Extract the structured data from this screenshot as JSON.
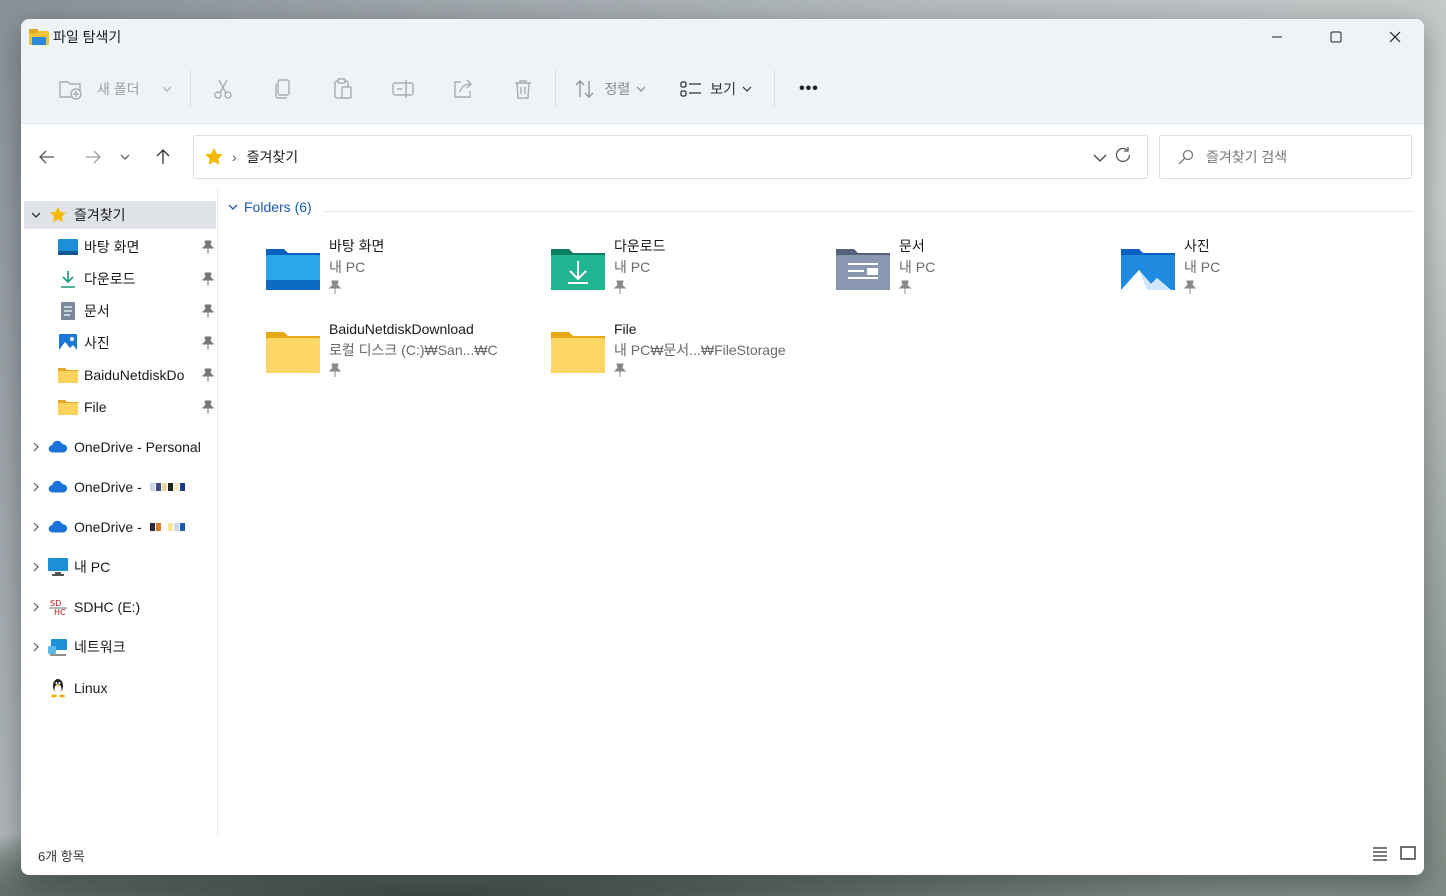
{
  "window": {
    "title": "파일 탐색기"
  },
  "toolbar": {
    "new_folder_label": "새 폴더",
    "sort_label": "정렬",
    "view_label": "보기",
    "more_label": "•••"
  },
  "address": {
    "location": "즐겨찾기",
    "separator": "›",
    "search_placeholder": "즐겨찾기 검색"
  },
  "sidebar": {
    "favorites_label": "즐겨찾기",
    "pinned": [
      {
        "label": "바탕 화면",
        "icon": "desktop-icon"
      },
      {
        "label": "다운로드",
        "icon": "download-icon"
      },
      {
        "label": "문서",
        "icon": "document-icon"
      },
      {
        "label": "사진",
        "icon": "pictures-icon"
      },
      {
        "label": "BaiduNetdiskDo",
        "icon": "folder-icon"
      },
      {
        "label": "File",
        "icon": "folder-icon"
      }
    ],
    "roots": [
      {
        "label": "OneDrive - Personal",
        "icon": "onedrive-icon"
      },
      {
        "label": "OneDrive -",
        "icon": "onedrive-icon"
      },
      {
        "label": "OneDrive -",
        "icon": "onedrive-icon"
      },
      {
        "label": "내 PC",
        "icon": "pc-icon"
      },
      {
        "label": "SDHC (E:)",
        "icon": "sd-card-icon"
      },
      {
        "label": "네트워크",
        "icon": "network-icon"
      },
      {
        "label": "Linux",
        "icon": "linux-icon"
      }
    ]
  },
  "content": {
    "group_title": "Folders (6)",
    "folders": [
      {
        "name": "바탕 화면",
        "location": "내 PC",
        "icon": "desktop-folder-icon"
      },
      {
        "name": "다운로드",
        "location": "내 PC",
        "icon": "downloads-folder-icon"
      },
      {
        "name": "문서",
        "location": "내 PC",
        "icon": "documents-folder-icon"
      },
      {
        "name": "사진",
        "location": "내 PC",
        "icon": "pictures-folder-icon"
      },
      {
        "name": "BaiduNetdiskDownload",
        "location": "로컬 디스크 (C:)₩San...₩C",
        "icon": "folder-icon"
      },
      {
        "name": "File",
        "location": "내 PC₩문서...₩FileStorage",
        "icon": "folder-icon"
      }
    ]
  },
  "status": {
    "item_count": "6개 항목"
  },
  "colors": {
    "accent": "#1e5aa8",
    "folder_yellow": "#f8c736",
    "selection": "#dfe2e6"
  }
}
